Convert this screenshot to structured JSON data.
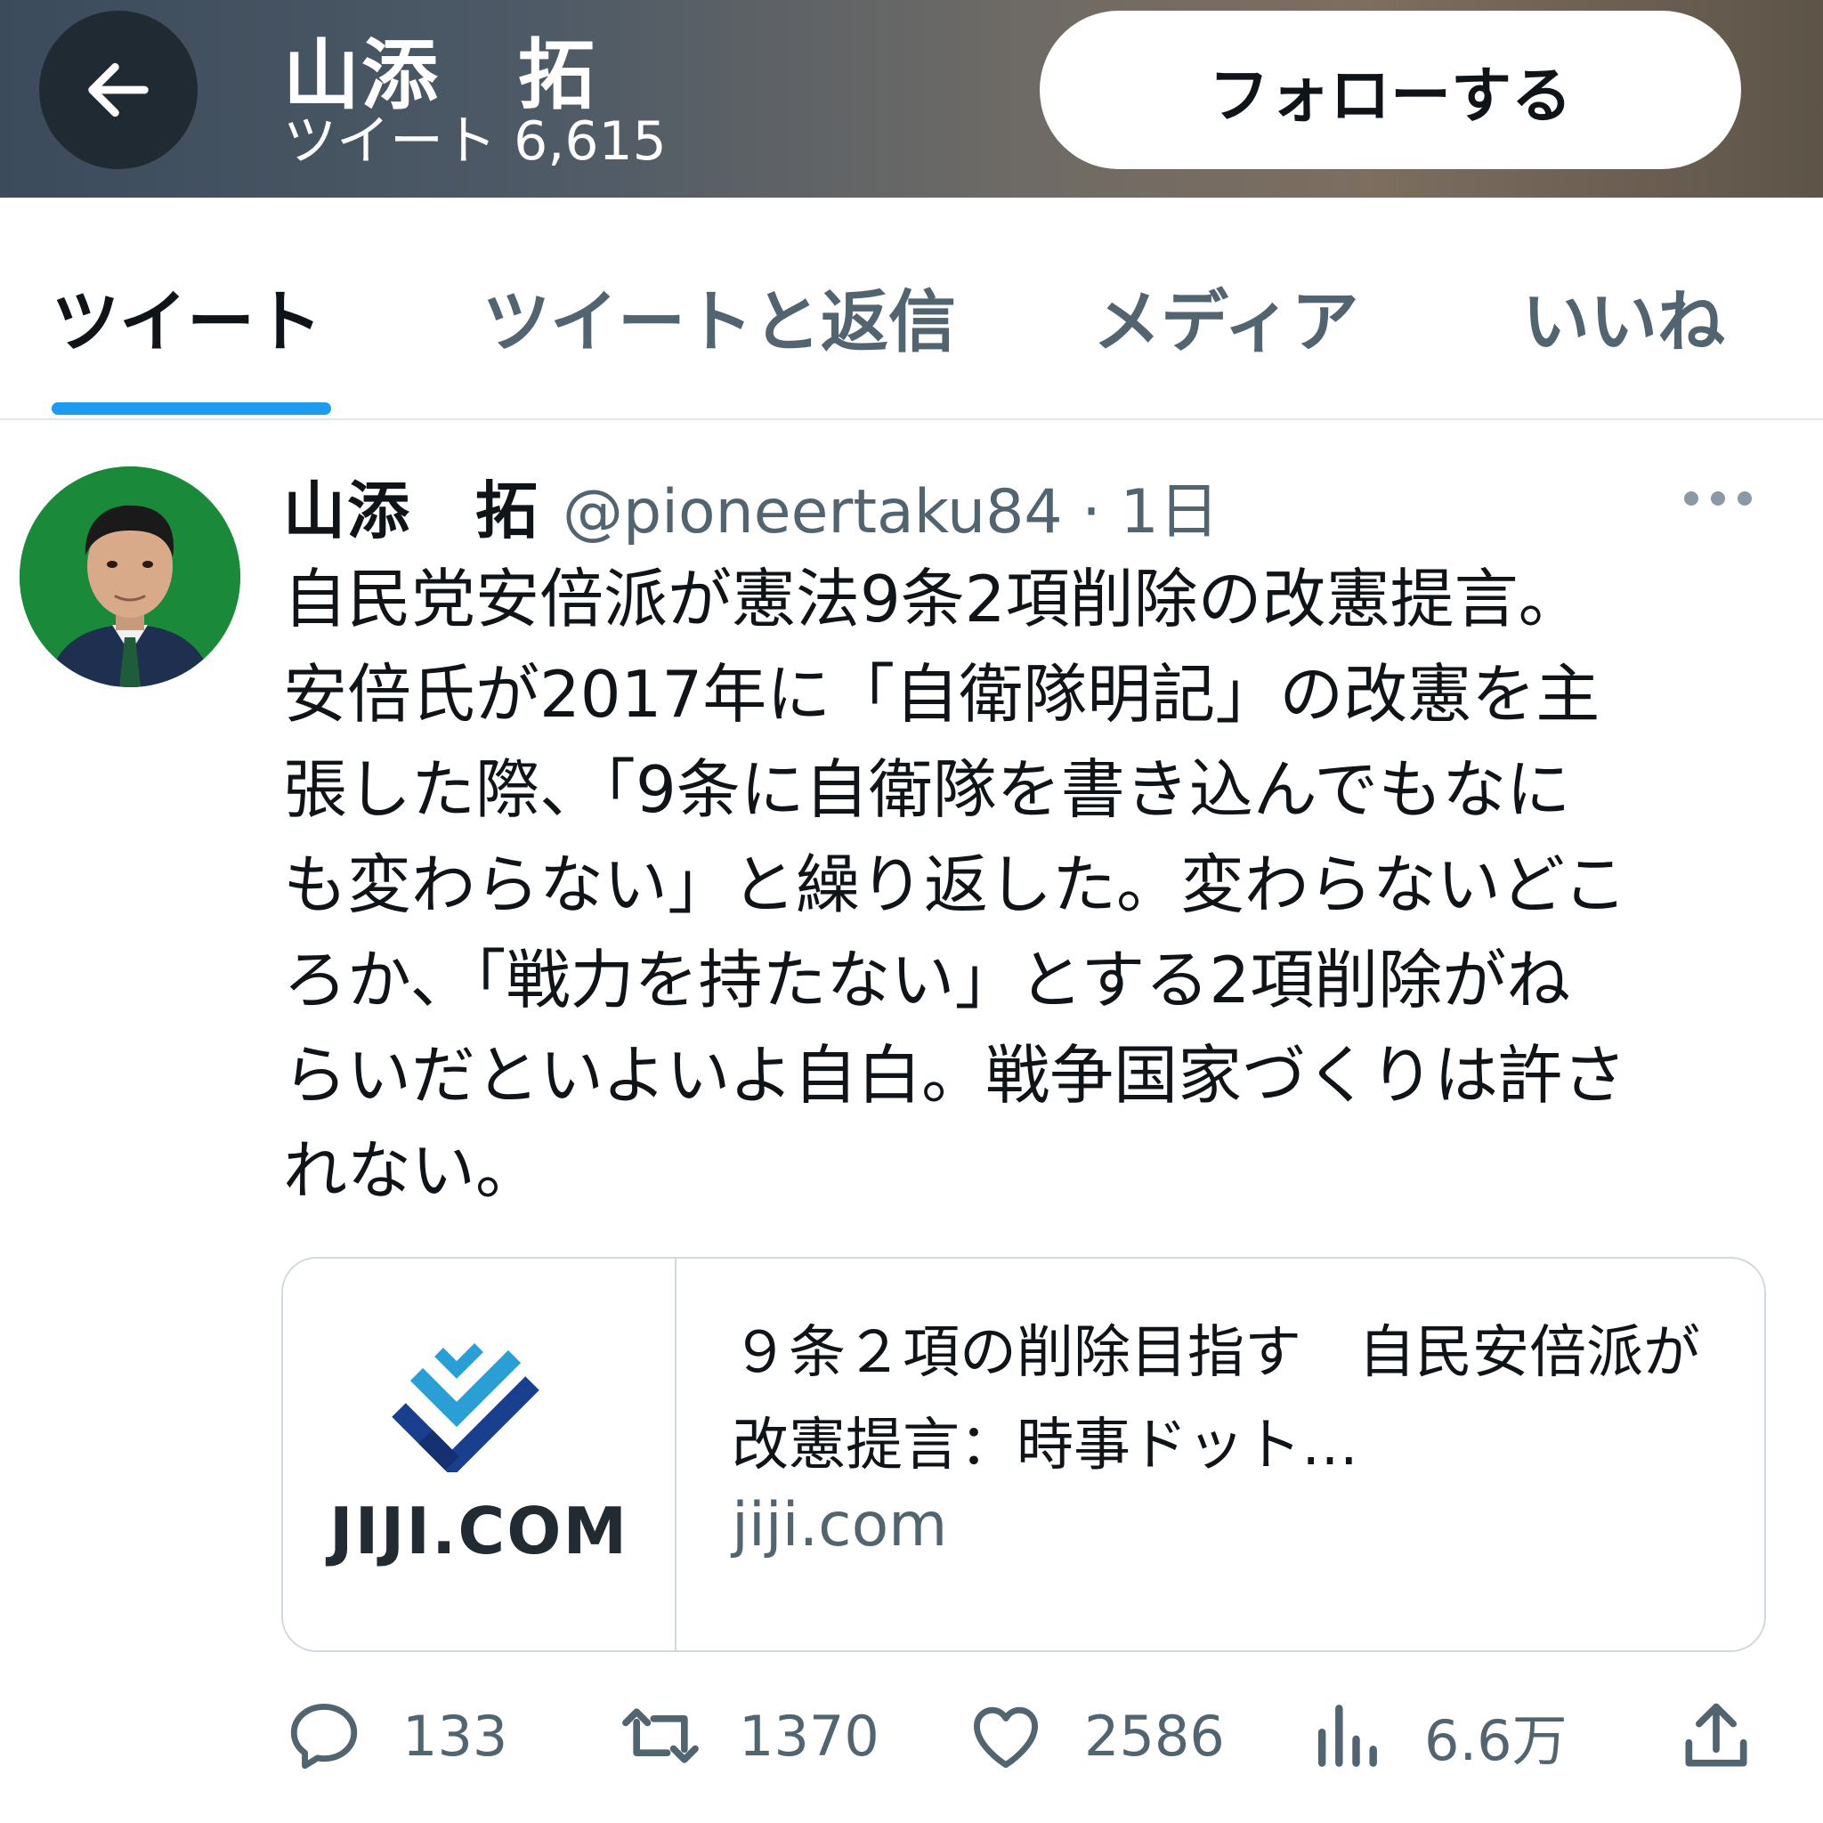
{
  "header": {
    "name": "山添　拓",
    "tweet_count_text": "ツイート 6,615",
    "follow_label": "フォローする"
  },
  "tabs": [
    {
      "label": "ツイート",
      "active": true
    },
    {
      "label": "ツイートと返信",
      "active": false
    },
    {
      "label": "メディア",
      "active": false
    },
    {
      "label": "いいね",
      "active": false
    }
  ],
  "tweet": {
    "author_name": "山添　拓",
    "handle_time": "@pioneertaku84 · 1日",
    "text": "自民党安倍派が憲法9条2項削除の改憲提言。\n安倍氏が2017年に「自衛隊明記」の改憲を主\n張した際、「9条に自衛隊を書き込んでもなに\nも変わらない」と繰り返した。変わらないどこ\nろか、「戦力を持たない」とする2項削除がね\nらいだといよいよ自白。戦争国家づくりは許さ\nれない。",
    "card": {
      "logo_text": "JIJI.COM",
      "title": "９条２項の削除目指す　自民安倍派が改憲提言：時事ドット…",
      "domain": "jiji.com"
    },
    "actions": {
      "reply_count": "133",
      "retweet_count": "1370",
      "like_count": "2586",
      "views_count": "6.6万"
    }
  },
  "colors": {
    "accent": "#1d9bf0",
    "secondary_text": "#536471",
    "primary_text": "#0f1419",
    "jiji_blue_light": "#2a9fd6",
    "jiji_blue_dark": "#1b3f8f"
  }
}
